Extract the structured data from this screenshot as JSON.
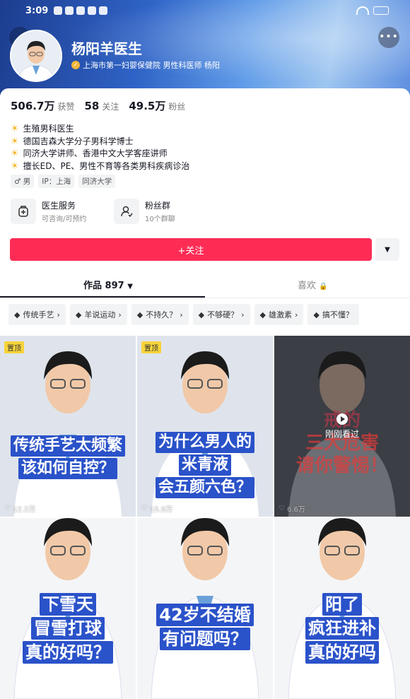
{
  "status_bar": {
    "time": "3:09"
  },
  "profile": {
    "name": "杨阳羊医生",
    "verification": "上海市第一妇婴保健院 男性科医师 杨阳",
    "stats": [
      {
        "value": "506.7万",
        "label": "获赞"
      },
      {
        "value": "58",
        "label": "关注"
      },
      {
        "value": "49.5万",
        "label": "粉丝"
      }
    ],
    "bio": [
      "生殖男科医生",
      "德国吉森大学分子男科学博士",
      "同济大学讲师、香港中文大学客座讲师",
      "擅长ED、PE、男性不育等各类男科疾病诊治"
    ],
    "tags": {
      "gender": "♂ 男",
      "ip": "IP：上海",
      "school": "同济大学"
    },
    "services": [
      {
        "title": "医生服务",
        "subtitle": "可咨询/可预约"
      },
      {
        "title": "粉丝群",
        "subtitle": "10个群聊"
      }
    ],
    "follow_label": "+关注"
  },
  "tabs": {
    "works": "作品 897",
    "likes": "喜欢"
  },
  "chips": [
    "传统手艺",
    "羊说运动",
    "不持久？",
    "不够硬？",
    "雄激素",
    "搞不懂？"
  ],
  "videos": [
    {
      "pinned": "置顶",
      "likes": "12.2万",
      "overlay": [
        "传统手艺太频繁",
        "该如何自控？"
      ]
    },
    {
      "pinned": "置顶",
      "likes": "15.9万",
      "overlay": [
        "为什么男人的",
        "米青液",
        "会五颜六色？"
      ]
    },
    {
      "watched": "刚刚看过",
      "likes": "6.6万",
      "overlay": [
        "戒的",
        "三大危害",
        "请你警惕！"
      ]
    },
    {
      "overlay": [
        "下雪天",
        "冒雪打球",
        "真的好吗？"
      ]
    },
    {
      "overlay": [
        "42岁不结婚",
        "有问题吗？"
      ]
    },
    {
      "overlay": [
        "阳了",
        "疯狂进补",
        "真的好吗"
      ]
    }
  ],
  "colors": {
    "accent": "#fe2c55",
    "pin": "#f7d43a",
    "sun": "#f2b31d"
  }
}
